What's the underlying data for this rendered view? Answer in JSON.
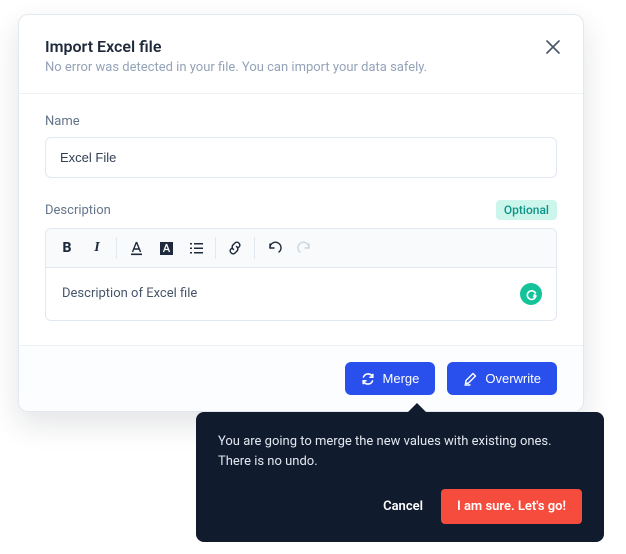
{
  "modal": {
    "title": "Import Excel file",
    "subtitle": "No error was detected in your file. You can import your data safely.",
    "name_label": "Name",
    "name_value": "Excel File",
    "description_label": "Description",
    "optional_badge": "Optional",
    "description_value": "Description of Excel file",
    "merge_label": "Merge",
    "overwrite_label": "Overwrite"
  },
  "confirm": {
    "text": "You are going to merge the new values with existing ones. There is no undo.",
    "cancel_label": "Cancel",
    "confirm_label": "I am sure. Let's go!"
  }
}
